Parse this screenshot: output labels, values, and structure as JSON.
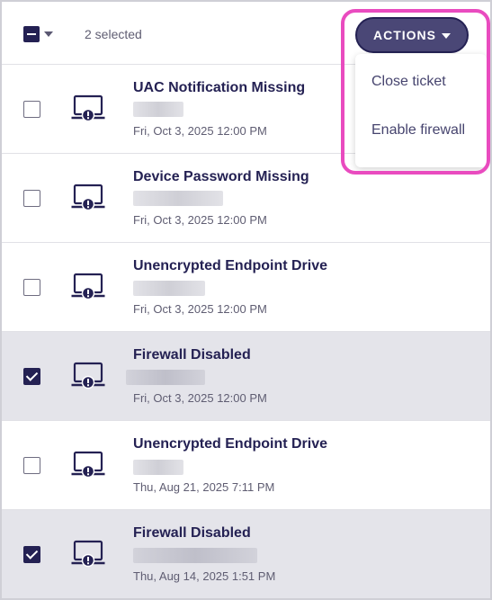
{
  "header": {
    "selected_count": "2 selected",
    "actions_label": "ACTIONS"
  },
  "actions_menu": {
    "items": [
      {
        "label": "Close ticket"
      },
      {
        "label": "Enable firewall"
      }
    ]
  },
  "colors": {
    "primary": "#242153",
    "button_bg": "#4a4776",
    "highlight": "#e94bbf",
    "selected_row_bg": "#e4e4ea"
  },
  "rows": [
    {
      "title": "UAC Notification Missing",
      "date": "Fri, Oct 3, 2025 12:00 PM",
      "checked": false,
      "icon": "laptop-alert-icon"
    },
    {
      "title": "Device Password Missing",
      "date": "Fri, Oct 3, 2025 12:00 PM",
      "checked": false,
      "icon": "laptop-alert-icon"
    },
    {
      "title": "Unencrypted Endpoint Drive",
      "date": "Fri, Oct 3, 2025 12:00 PM",
      "checked": false,
      "icon": "laptop-alert-icon"
    },
    {
      "title": "Firewall Disabled",
      "date": "Fri, Oct 3, 2025 12:00 PM",
      "checked": true,
      "icon": "laptop-alert-icon"
    },
    {
      "title": "Unencrypted Endpoint Drive",
      "date": "Thu, Aug 21, 2025 7:11 PM",
      "checked": false,
      "icon": "laptop-alert-icon"
    },
    {
      "title": "Firewall Disabled",
      "date": "Thu, Aug 14, 2025 1:51 PM",
      "checked": true,
      "icon": "laptop-alert-icon"
    }
  ]
}
